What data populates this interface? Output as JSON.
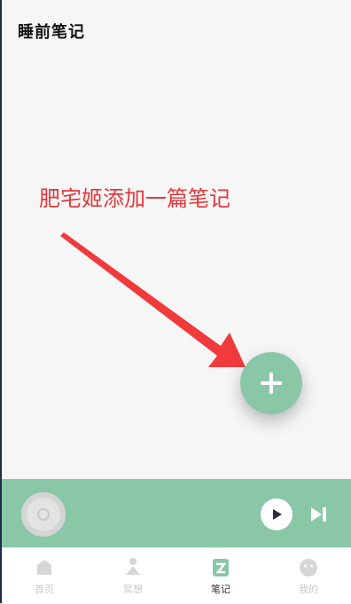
{
  "app": {
    "title": "睡前笔记"
  },
  "annotation": {
    "text": "肥宅姬添加一篇笔记",
    "color": "#e4373a"
  },
  "fab": {
    "icon": "plus-icon",
    "color": "#89c7a6"
  },
  "player": {
    "background": "#89c7a6",
    "disc_icon": "music-disc-icon",
    "play_icon": "play-icon",
    "next_icon": "skip-next-icon"
  },
  "tabs": [
    {
      "label": "首页",
      "icon": "home-icon",
      "active": false
    },
    {
      "label": "冥想",
      "icon": "meditate-icon",
      "active": false
    },
    {
      "label": "笔记",
      "icon": "note-icon",
      "active": true
    },
    {
      "label": "我的",
      "icon": "profile-icon",
      "active": false
    }
  ],
  "colors": {
    "accent": "#89c7a6",
    "background": "#f6f6f6",
    "inactive": "#c9c9c9"
  }
}
